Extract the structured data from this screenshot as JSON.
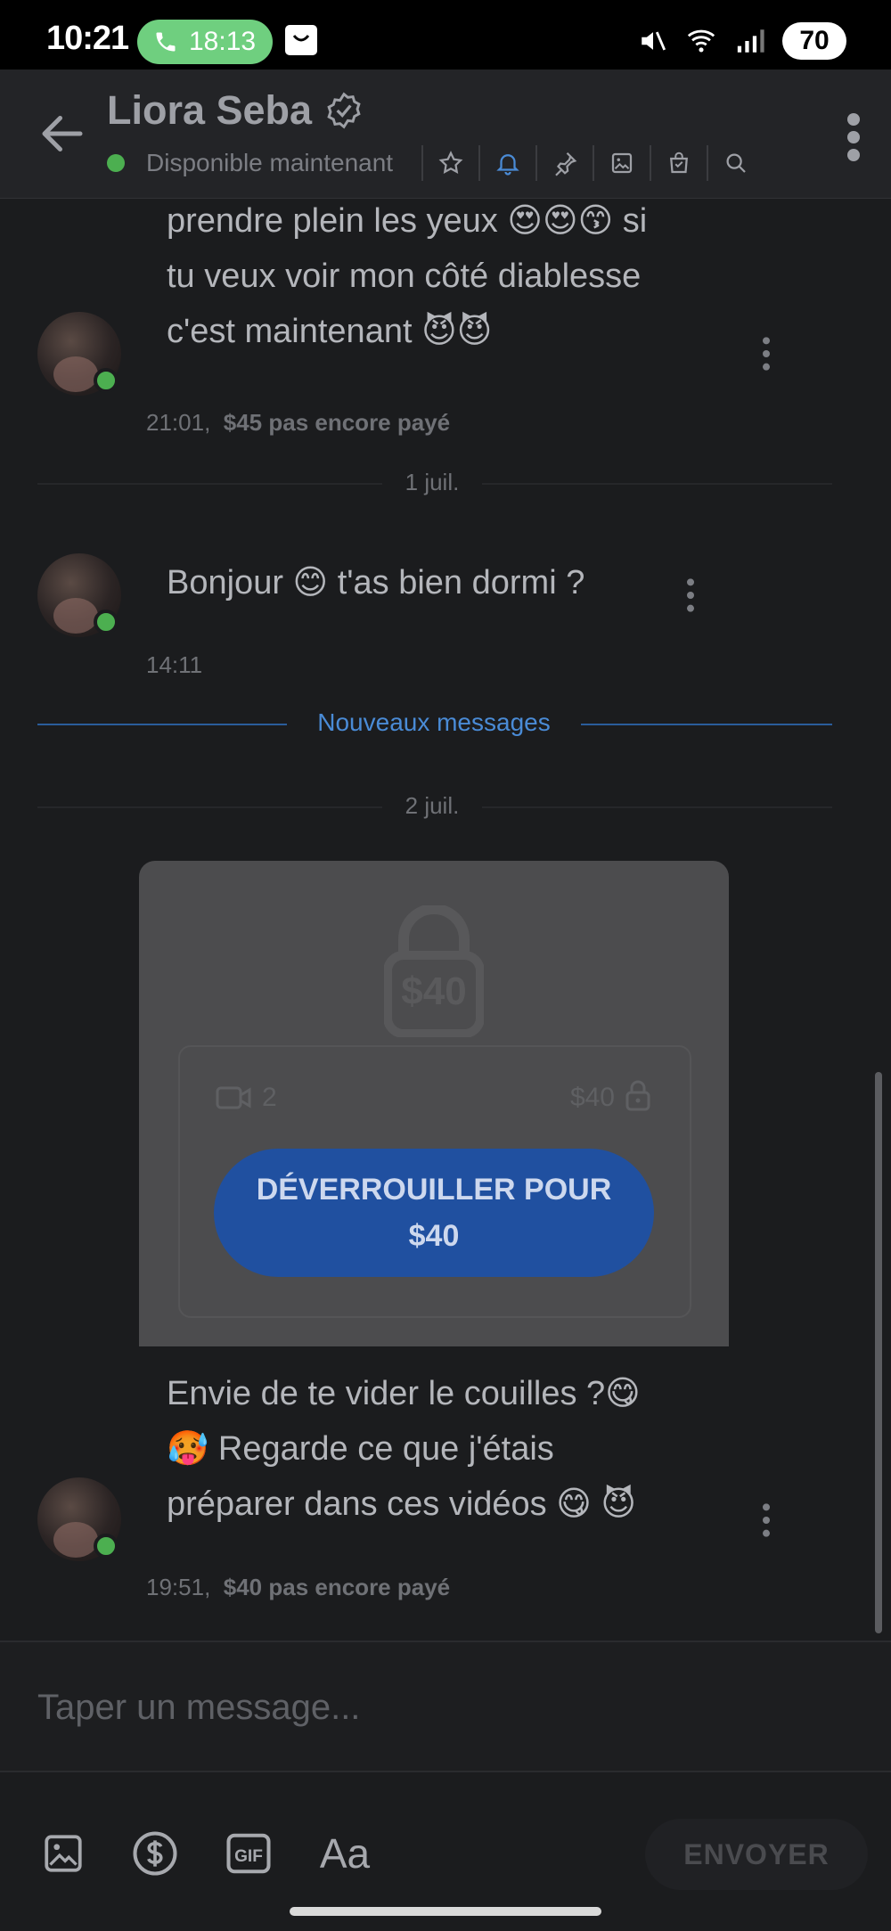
{
  "status_bar": {
    "time": "10:21",
    "call_time": "18:13",
    "battery": "70"
  },
  "header": {
    "name": "Liora Seba",
    "status": "Disponible maintenant"
  },
  "messages": [
    {
      "lines": [
        "prendre plein les yeux 😍😍😙 si",
        "tu veux voir mon côté diablesse",
        "c'est maintenant 😈😈"
      ],
      "time": "21:01,",
      "price_note": "$45 pas encore payé"
    },
    {
      "lines": [
        "Bonjour 😊 t'as bien dormi ?"
      ],
      "time": "14:11",
      "price_note": ""
    },
    {
      "lines": [
        "Envie de te vider le couilles ?😋",
        "🥵 Regarde ce que j'étais",
        "préparer dans ces vidéos 😋 😈"
      ],
      "time": "19:51,",
      "price_note": "$40 pas encore payé"
    }
  ],
  "dividers": {
    "date1": "1 juil.",
    "new_messages": "Nouveaux messages",
    "date2": "2 juil."
  },
  "locked_media": {
    "lock_price": "$40",
    "video_count": "2",
    "price": "$40",
    "unlock_line1": "DÉVERROUILLER POUR",
    "unlock_line2": "$40"
  },
  "composer": {
    "placeholder": "Taper un message..."
  },
  "toolbar": {
    "text_format_label": "Aa",
    "send_label": "ENVOYER"
  },
  "colors": {
    "accent_blue": "#2050a0",
    "new_messages_blue": "#4a8bd6",
    "online_green": "#4caf50",
    "call_pill_green": "#6fcf7f"
  }
}
